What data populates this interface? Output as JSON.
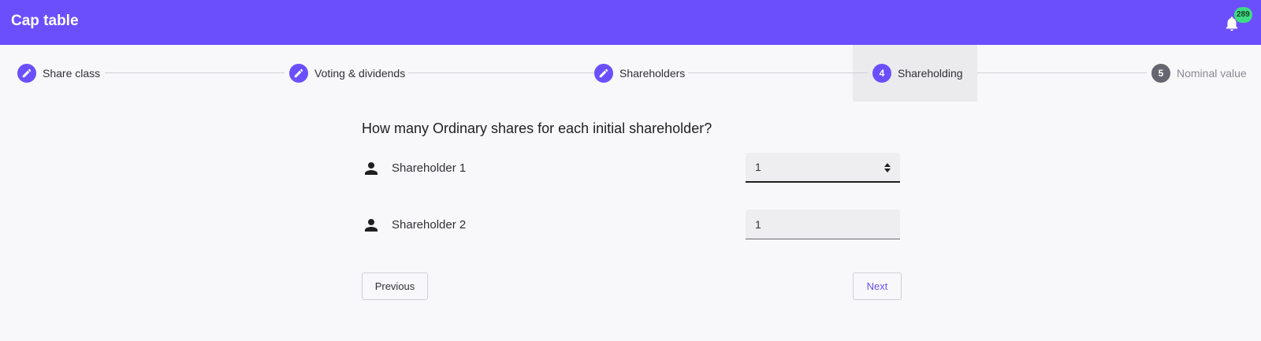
{
  "app": {
    "title": "Cap table",
    "accent_color": "#6c4ffc"
  },
  "notifications": {
    "count": "289",
    "icon": "bell-icon",
    "badge_color": "#3ddc84"
  },
  "stepper": {
    "steps": [
      {
        "label": "Share class",
        "icon": "pencil-icon",
        "state": "completed"
      },
      {
        "label": "Voting & dividends",
        "icon": "pencil-icon",
        "state": "completed"
      },
      {
        "label": "Shareholders",
        "icon": "pencil-icon",
        "state": "completed"
      },
      {
        "number": "4",
        "label": "Shareholding",
        "state": "active"
      },
      {
        "number": "5",
        "label": "Nominal value",
        "state": "upcoming"
      }
    ]
  },
  "form": {
    "question": "How many Ordinary shares for each initial shareholder?",
    "rows": [
      {
        "label": "Shareholder 1",
        "value": "1",
        "icon": "person-icon"
      },
      {
        "label": "Shareholder 2",
        "value": "1",
        "icon": "person-icon"
      }
    ],
    "previous_label": "Previous",
    "next_label": "Next"
  }
}
